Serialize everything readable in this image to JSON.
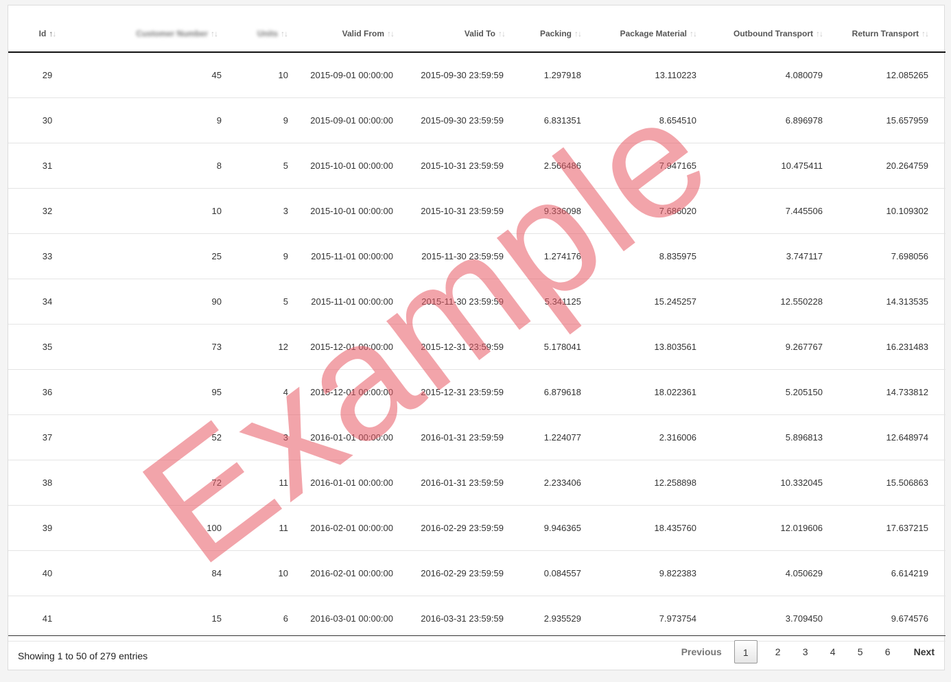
{
  "columns": [
    {
      "label": "Id"
    },
    {
      "label": "Customer Number"
    },
    {
      "label": "Units"
    },
    {
      "label": "Valid From"
    },
    {
      "label": "Valid To"
    },
    {
      "label": "Packing"
    },
    {
      "label": "Package Material"
    },
    {
      "label": "Outbound Transport"
    },
    {
      "label": "Return Transport"
    }
  ],
  "sort_active_column": "Id",
  "rows": [
    [
      "29",
      "45",
      "10",
      "2015-09-01 00:00:00",
      "2015-09-30 23:59:59",
      "1.297918",
      "13.110223",
      "4.080079",
      "12.085265"
    ],
    [
      "30",
      "9",
      "9",
      "2015-09-01 00:00:00",
      "2015-09-30 23:59:59",
      "6.831351",
      "8.654510",
      "6.896978",
      "15.657959"
    ],
    [
      "31",
      "8",
      "5",
      "2015-10-01 00:00:00",
      "2015-10-31 23:59:59",
      "2.566486",
      "7.947165",
      "10.475411",
      "20.264759"
    ],
    [
      "32",
      "10",
      "3",
      "2015-10-01 00:00:00",
      "2015-10-31 23:59:59",
      "9.336098",
      "7.686020",
      "7.445506",
      "10.109302"
    ],
    [
      "33",
      "25",
      "9",
      "2015-11-01 00:00:00",
      "2015-11-30 23:59:59",
      "1.274176",
      "8.835975",
      "3.747117",
      "7.698056"
    ],
    [
      "34",
      "90",
      "5",
      "2015-11-01 00:00:00",
      "2015-11-30 23:59:59",
      "5.341125",
      "15.245257",
      "12.550228",
      "14.313535"
    ],
    [
      "35",
      "73",
      "12",
      "2015-12-01 00:00:00",
      "2015-12-31 23:59:59",
      "5.178041",
      "13.803561",
      "9.267767",
      "16.231483"
    ],
    [
      "36",
      "95",
      "4",
      "2015-12-01 00:00:00",
      "2015-12-31 23:59:59",
      "6.879618",
      "18.022361",
      "5.205150",
      "14.733812"
    ],
    [
      "37",
      "52",
      "3",
      "2016-01-01 00:00:00",
      "2016-01-31 23:59:59",
      "1.224077",
      "2.316006",
      "5.896813",
      "12.648974"
    ],
    [
      "38",
      "72",
      "11",
      "2016-01-01 00:00:00",
      "2016-01-31 23:59:59",
      "2.233406",
      "12.258898",
      "10.332045",
      "15.506863"
    ],
    [
      "39",
      "100",
      "11",
      "2016-02-01 00:00:00",
      "2016-02-29 23:59:59",
      "9.946365",
      "18.435760",
      "12.019606",
      "17.637215"
    ],
    [
      "40",
      "84",
      "10",
      "2016-02-01 00:00:00",
      "2016-02-29 23:59:59",
      "0.084557",
      "9.822383",
      "4.050629",
      "6.614219"
    ],
    [
      "41",
      "15",
      "6",
      "2016-03-01 00:00:00",
      "2016-03-31 23:59:59",
      "2.935529",
      "7.973754",
      "3.709450",
      "9.674576"
    ]
  ],
  "footer": {
    "info": "Showing 1 to 50 of 279 entries",
    "previous": "Previous",
    "next": "Next",
    "pages": [
      "1",
      "2",
      "3",
      "4",
      "5",
      "6"
    ],
    "current_page": "1"
  },
  "watermark": "Example",
  "colors": {
    "watermark": "#e85a64",
    "header_rule": "#111111"
  }
}
